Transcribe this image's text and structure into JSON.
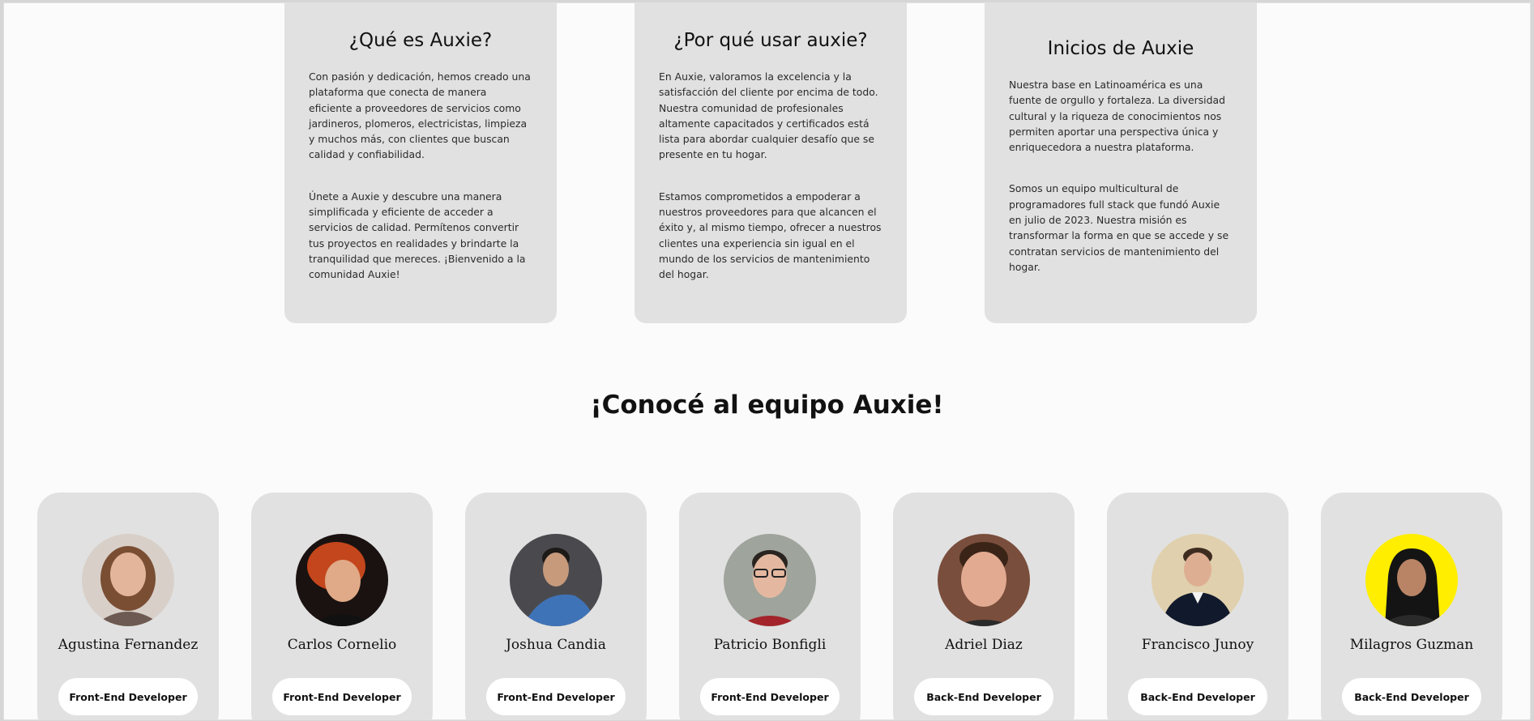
{
  "info_cards": [
    {
      "title": "¿Qué es Auxie?",
      "paragraphs": [
        "Con pasión y dedicación, hemos creado una plataforma que conecta de manera eficiente a proveedores de servicios como jardineros, plomeros, electricistas, limpieza y muchos más, con clientes que buscan calidad y confiabilidad.",
        "Únete a Auxie y descubre una manera simplificada y eficiente de acceder a servicios de calidad. Permítenos convertir tus proyectos en realidades y brindarte la tranquilidad que mereces. ¡Bienvenido a la comunidad Auxie!"
      ]
    },
    {
      "title": "¿Por qué usar auxie?",
      "paragraphs": [
        "En Auxie, valoramos la excelencia y la satisfacción del cliente por encima de todo. Nuestra comunidad de profesionales altamente capacitados y certificados está lista para abordar cualquier desafío que se presente en tu hogar.",
        "Estamos comprometidos a empoderar a nuestros proveedores para que alcancen el éxito y, al mismo tiempo, ofrecer a nuestros clientes una experiencia sin igual en el mundo de los servicios de mantenimiento del hogar."
      ]
    },
    {
      "title": "Inicios de Auxie",
      "paragraphs": [
        "Nuestra base en Latinoamérica es una fuente de orgullo y fortaleza. La diversidad cultural y la riqueza de conocimientos nos permiten aportar una perspectiva única y enriquecedora a nuestra plataforma.",
        "Somos un equipo multicultural de programadores full stack que fundó Auxie en julio de 2023. Nuestra misión es transformar la forma en que se accede y se contratan servicios de mantenimiento del hogar."
      ]
    }
  ],
  "team": {
    "heading": "¡Conocé al equipo Auxie!",
    "members": [
      {
        "name": "Agustina Fernandez",
        "role": "Front-End Developer",
        "photo": "avatar-photo"
      },
      {
        "name": "Carlos Cornelio",
        "role": "Front-End Developer",
        "photo": "avatar-photo"
      },
      {
        "name": "Joshua Candia",
        "role": "Front-End Developer",
        "photo": "avatar-photo"
      },
      {
        "name": "Patricio Bonfigli",
        "role": "Front-End Developer",
        "photo": "avatar-photo"
      },
      {
        "name": "Adriel Diaz",
        "role": "Back-End Developer",
        "photo": "avatar-photo"
      },
      {
        "name": "Francisco Junoy",
        "role": "Back-End Developer",
        "photo": "avatar-photo"
      },
      {
        "name": "Milagros Guzman",
        "role": "Back-End Developer",
        "photo": "avatar-photo"
      }
    ]
  },
  "colors": {
    "page_background": "#fbfbfb",
    "card_background": "#e1e1e1",
    "button_background": "#ffffff",
    "text": "#111111"
  }
}
